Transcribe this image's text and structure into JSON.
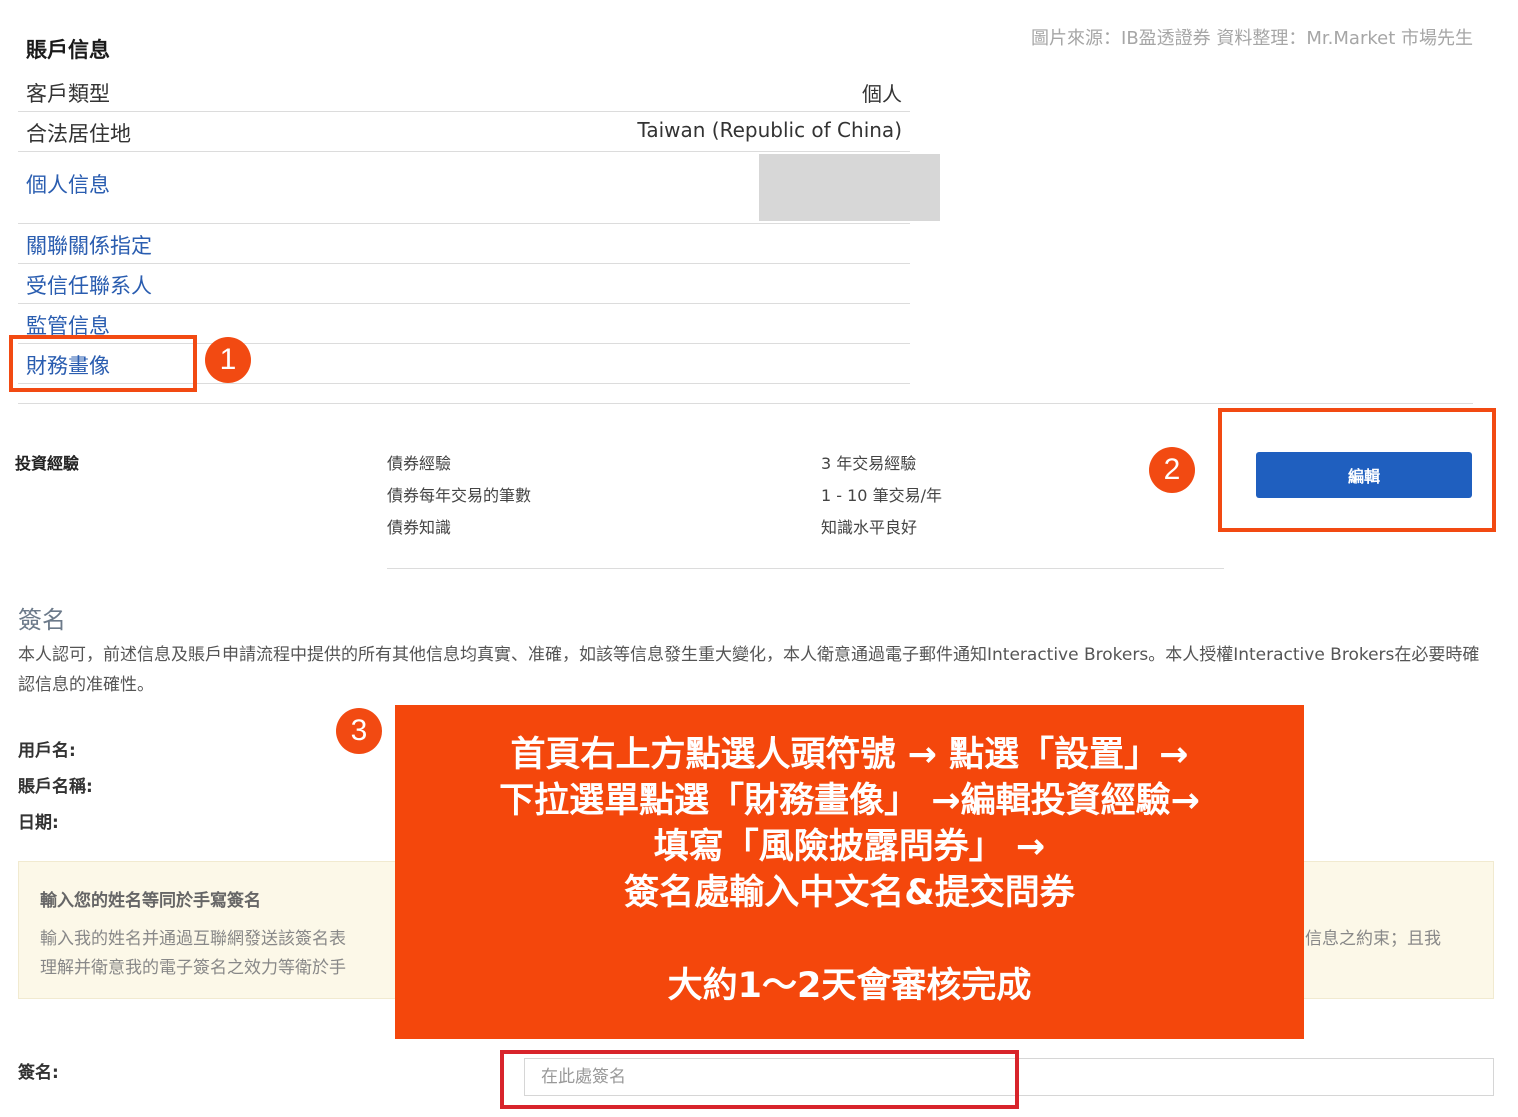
{
  "source_credit": "圖片來源：IB盈透證券   資料整理：Mr.Market 市場先生",
  "account": {
    "title": "賬戶信息",
    "client_type_label": "客戶類型",
    "client_type_value": "個人",
    "residence_label": "合法居住地",
    "residence_value": "Taiwan (Republic of China)",
    "links": [
      "個人信息",
      "關聯關係指定",
      "受信任聯系人",
      "監管信息",
      "財務畫像"
    ]
  },
  "markers": [
    "1",
    "2",
    "3"
  ],
  "investment": {
    "title": "投資經驗",
    "items": [
      {
        "label": "債券經驗",
        "value": "3 年交易經驗"
      },
      {
        "label": "債券每年交易的筆數",
        "value": "1 - 10 筆交易/年"
      },
      {
        "label": "債券知識",
        "value": "知識水平良好"
      }
    ],
    "edit_label": "編輯"
  },
  "signature": {
    "title": "簽名",
    "text": "本人認可，前述信息及賬戶申請流程中提供的所有其他信息均真實、准確，如該等信息發生重大變化，本人衛意通過電子郵件通知Interactive Brokers。本人授權Interactive Brokers在必要時確認信息的准確性。",
    "username_label": "用戶名:",
    "account_name_label": "賬戶名稱:",
    "date_label": "日期:",
    "notice_title": "輸入您的姓名等同於手寫簽名",
    "notice_line1_start": "輸入我的姓名并通過互聯網發送該簽名表",
    "notice_line1_end": "信息之約束；且我",
    "notice_line2": "理解并衛意我的電子簽名之效力等衛於手",
    "sign_label": "簽名:",
    "sign_placeholder": "在此處簽名"
  },
  "callout": {
    "lines": [
      "首頁右上方點選人頭符號 → 點選「設置」→",
      "下拉選單點選「財務畫像」 →編輯投資經驗→",
      "填寫「風險披露問券」 →",
      "簽名處輸入中文名&提交問券"
    ],
    "footer": "大約1～2天會審核完成"
  },
  "colors": {
    "marker": "#f24a12",
    "callout": "#f4470c",
    "button": "#1f5fbf",
    "link": "#2a5db0"
  }
}
